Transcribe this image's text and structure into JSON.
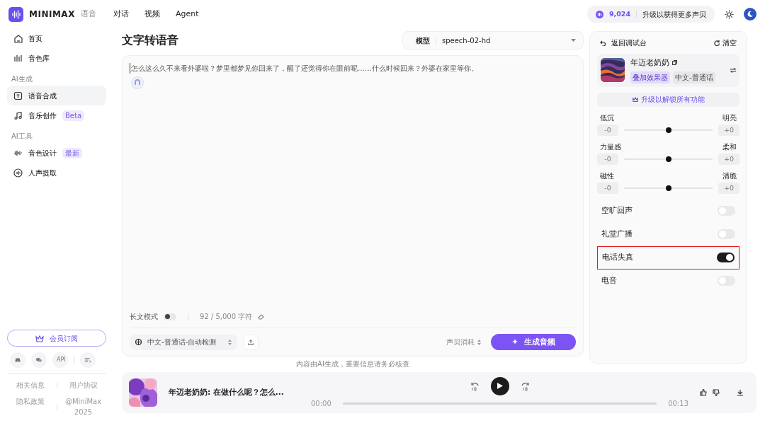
{
  "nav": {
    "brand": "MINIMAX",
    "product": "语音",
    "links": [
      {
        "label": "对话",
        "selected": false
      },
      {
        "label": "视频",
        "selected": false
      },
      {
        "label": "Agent",
        "selected": false
      }
    ],
    "credits": "9,024",
    "upgrade": "升级以获得更多声贝"
  },
  "sidebar": {
    "groups": [
      {
        "items": [
          {
            "label": "首页",
            "selected": false
          },
          {
            "label": "音色库",
            "selected": false
          }
        ]
      },
      {
        "heading": "AI生成",
        "items": [
          {
            "label": "语音合成",
            "selected": true
          },
          {
            "label": "音乐创作",
            "selected": false,
            "badge": "Beta"
          }
        ]
      },
      {
        "heading": "AI工具",
        "items": [
          {
            "label": "音色设计",
            "selected": false,
            "badge": "最新"
          },
          {
            "label": "人声提取",
            "selected": false
          }
        ]
      }
    ],
    "subscribe": "会员订阅",
    "api": "API",
    "links": [
      "相关信息",
      "用户协议",
      "隐私政策",
      "@MiniMax 2025"
    ]
  },
  "editor": {
    "title": "文字转语音",
    "model_label": "模型",
    "model_value": "speech-02-hd",
    "text": "怎么这么久不来看外婆啦？梦里都梦见你回来了，醒了还觉得你在眼前呢……什么时候回来？外婆在家里等你。",
    "long_mode_label": "长文模式",
    "long_mode_on": false,
    "char_count": "92 / 5,000 字符",
    "language": "中文-普通话-自动检测",
    "cost_label": "声贝消耗",
    "generate": "生成音频"
  },
  "disclaimer": "内容由AI生成，重要信息请务必核查",
  "player": {
    "title": "年迈老奶奶: 在做什么呢？怎么...",
    "time_start": "00:00",
    "time_end": "00:13",
    "level": 0
  },
  "panel": {
    "back": "返回调试台",
    "clear": "清空",
    "voice_name": "年迈老奶奶",
    "tags": [
      "叠加效果器",
      "中文-普通话"
    ],
    "upgrade": "升级以解锁所有功能",
    "sliders": [
      {
        "left": "低沉",
        "right": "明亮",
        "left_value": "-0",
        "right_value": "+0",
        "level": 0.5
      },
      {
        "left": "力量感",
        "right": "柔和",
        "left_value": "-0",
        "right_value": "+0",
        "level": 0.5
      },
      {
        "left": "磁性",
        "right": "清脆",
        "left_value": "-0",
        "right_value": "+0",
        "level": 0.5
      }
    ],
    "effects": [
      {
        "label": "空旷回声",
        "on": false,
        "highlighted": false
      },
      {
        "label": "礼堂广播",
        "on": false,
        "highlighted": false
      },
      {
        "label": "电话失真",
        "on": true,
        "highlighted": true
      },
      {
        "label": "电音",
        "on": false,
        "highlighted": false
      }
    ]
  }
}
